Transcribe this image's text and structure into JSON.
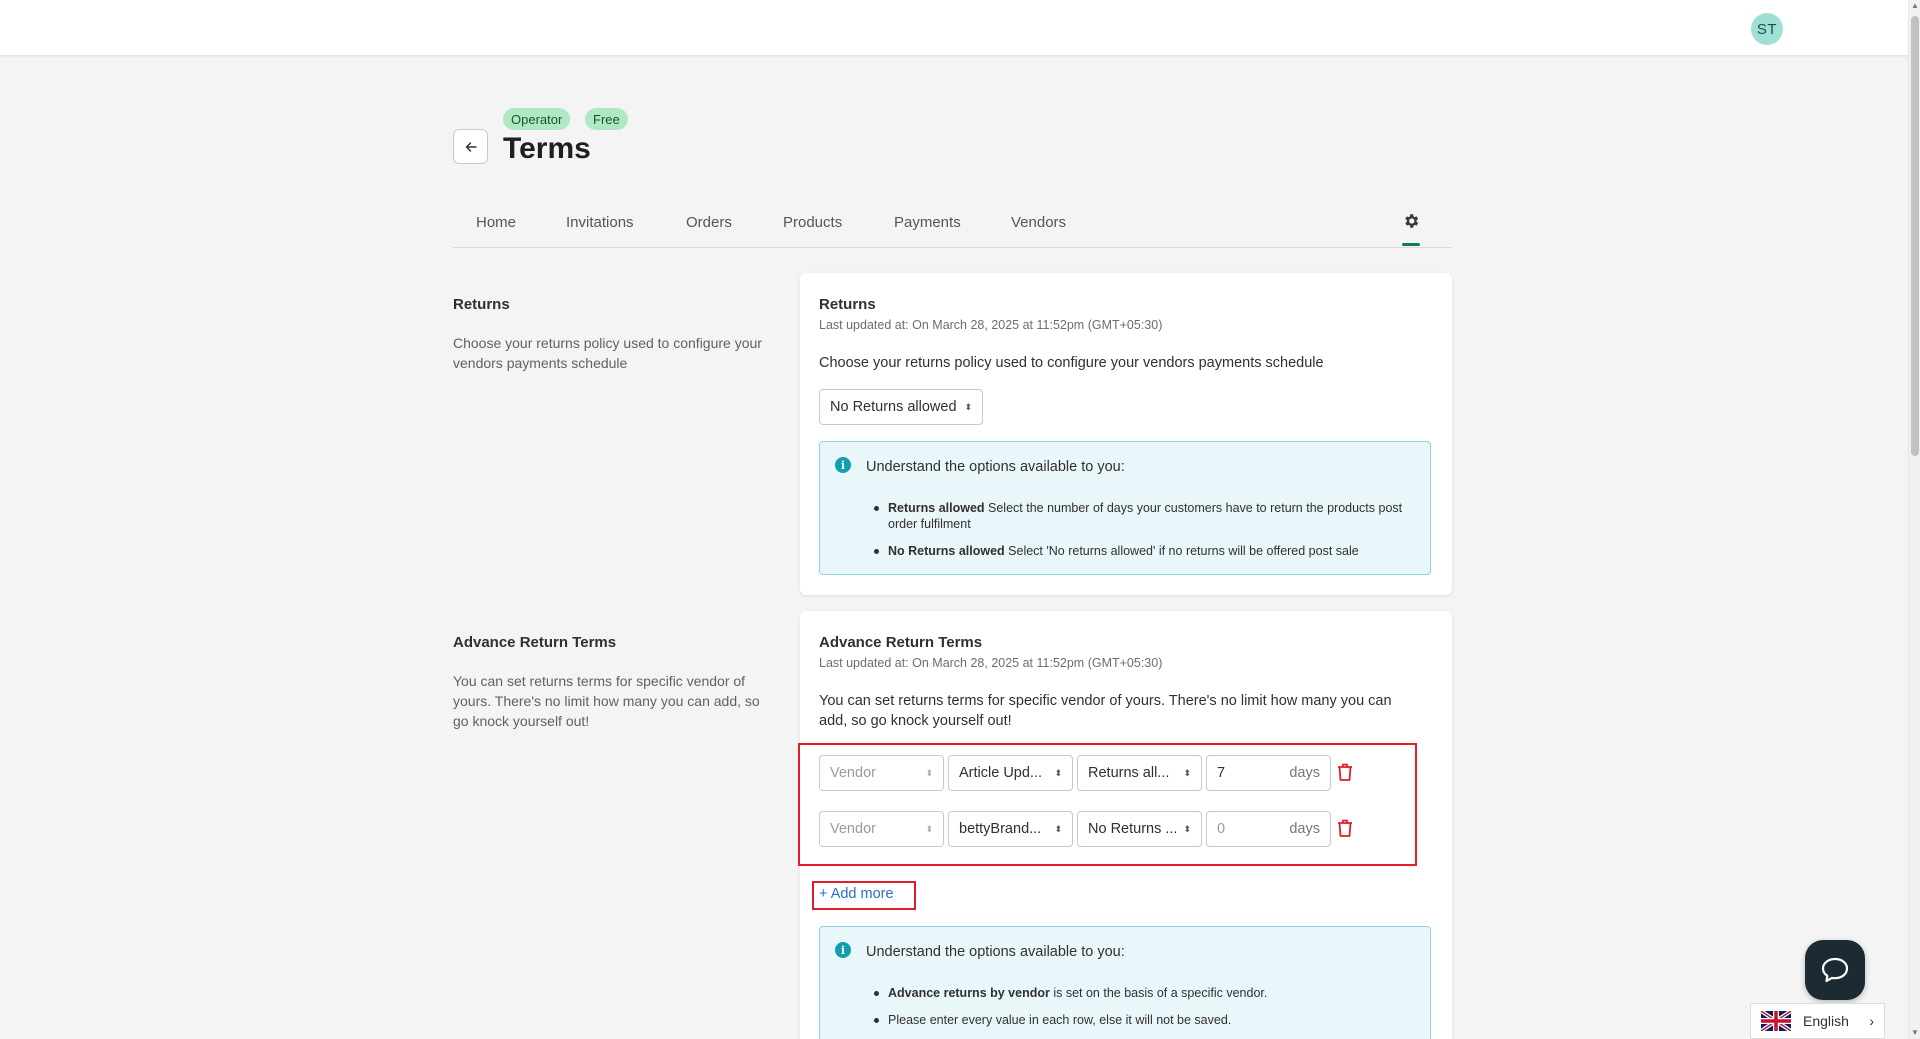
{
  "header": {
    "avatar_initials": "ST"
  },
  "page": {
    "badges": [
      "Operator",
      "Free"
    ],
    "title": "Terms"
  },
  "tabs": [
    {
      "label": "Home"
    },
    {
      "label": "Invitations"
    },
    {
      "label": "Orders"
    },
    {
      "label": "Products"
    },
    {
      "label": "Payments"
    },
    {
      "label": "Vendors"
    }
  ],
  "returns_section": {
    "title": "Returns",
    "description": "Choose your returns policy used to configure your vendors payments schedule",
    "card": {
      "title": "Returns",
      "last_updated": "Last updated at: On March 28, 2025 at 11:52pm (GMT+05:30)",
      "text": "Choose your returns policy used to configure your vendors payments schedule",
      "policy_select": "No Returns allowed",
      "info": {
        "heading": "Understand the options available to you:",
        "items": [
          {
            "bold": "Returns allowed",
            "text": " Select the number of days your customers have to return the products post order fulfilment"
          },
          {
            "bold": "No Returns allowed",
            "text": " Select 'No returns allowed' if no returns will be offered post sale"
          }
        ]
      }
    }
  },
  "advance_section": {
    "title": "Advance Return Terms",
    "description": "You can set returns terms for specific vendor of yours. There's no limit how many you can add, so go knock yourself out!",
    "card": {
      "title": "Advance Return Terms",
      "last_updated": "Last updated at: On March 28, 2025 at 11:52pm (GMT+05:30)",
      "text": "You can set returns terms for specific vendor of yours. There's no limit how many you can add, so go knock yourself out!",
      "rows": [
        {
          "vendor_placeholder": "Vendor",
          "brand": "Article Upd...",
          "policy": "Returns all...",
          "days": "7",
          "days_unit": "days"
        },
        {
          "vendor_placeholder": "Vendor",
          "brand": "bettyBrand...",
          "policy": "No Returns ...",
          "days": "0",
          "days_unit": "days"
        }
      ],
      "add_more": "+ Add more",
      "info": {
        "heading": "Understand the options available to you:",
        "items": [
          {
            "bold": "Advance returns by vendor",
            "text": " is set on the basis of a specific vendor."
          },
          {
            "bold": "",
            "text": "Please enter every value in each row, else it will not be saved."
          }
        ]
      }
    }
  },
  "language": {
    "label": "English"
  },
  "colors": {
    "accent": "#0f7a5c",
    "badge_bg": "#aee9c4",
    "info_bg": "#eaf7fa",
    "danger": "#e11d2a",
    "link": "#2c6ecb"
  }
}
